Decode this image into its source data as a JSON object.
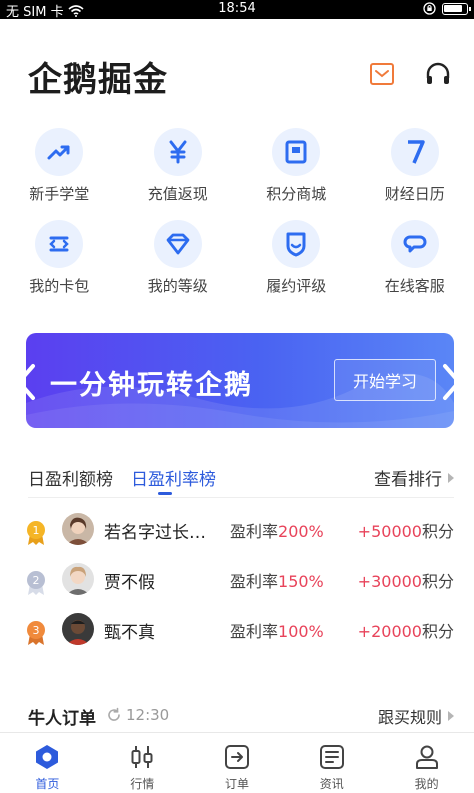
{
  "status_bar": {
    "carrier": "无 SIM 卡",
    "time": "18:54",
    "battery_level": 0.85
  },
  "header": {
    "title": "企鹅掘金",
    "icons": [
      "envelope-icon",
      "headset-icon"
    ]
  },
  "grid": [
    {
      "label": "新手学堂",
      "icon": "trend-up-icon"
    },
    {
      "label": "充值返现",
      "icon": "yen-icon"
    },
    {
      "label": "积分商城",
      "icon": "store-icon"
    },
    {
      "label": "财经日历",
      "icon": "calendar-7-icon"
    },
    {
      "label": "我的卡包",
      "icon": "card-icon"
    },
    {
      "label": "我的等级",
      "icon": "diamond-icon"
    },
    {
      "label": "履约评级",
      "icon": "shield-icon"
    },
    {
      "label": "在线客服",
      "icon": "chat-icon"
    }
  ],
  "banner": {
    "title": "一分钟玩转企鹅",
    "button": "开始学习"
  },
  "ranking": {
    "tabs": [
      "日盈利额榜",
      "日盈利率榜"
    ],
    "active_tab": 1,
    "view_all": "查看排行",
    "rows": [
      {
        "rank": "1",
        "name": "若名字过长…",
        "rate_label": "盈利率",
        "rate": "200%",
        "points": "+50000",
        "points_unit": "积分",
        "medal_color": "#f5b526"
      },
      {
        "rank": "2",
        "name": "贾不假",
        "rate_label": "盈利率",
        "rate": "150%",
        "points": "+30000",
        "points_unit": "积分",
        "medal_color": "#b8bfd3"
      },
      {
        "rank": "3",
        "name": "甄不真",
        "rate_label": "盈利率",
        "rate": "100%",
        "points": "+20000",
        "points_unit": "积分",
        "medal_color": "#f08a3c"
      }
    ]
  },
  "orders": {
    "title": "牛人订单",
    "time": "12:30",
    "rules": "跟买规则"
  },
  "bottom_nav": [
    {
      "label": "首页",
      "icon": "home-icon",
      "active": true
    },
    {
      "label": "行情",
      "icon": "candlestick-icon",
      "active": false
    },
    {
      "label": "订单",
      "icon": "order-icon",
      "active": false
    },
    {
      "label": "资讯",
      "icon": "news-icon",
      "active": false
    },
    {
      "label": "我的",
      "icon": "profile-icon",
      "active": false
    }
  ],
  "colors": {
    "accent": "#2d5bdc",
    "icon_bg": "#eaf1fe",
    "profit_red": "#e8435a",
    "banner_start": "#5b3ff0",
    "banner_end": "#5a86f6"
  }
}
